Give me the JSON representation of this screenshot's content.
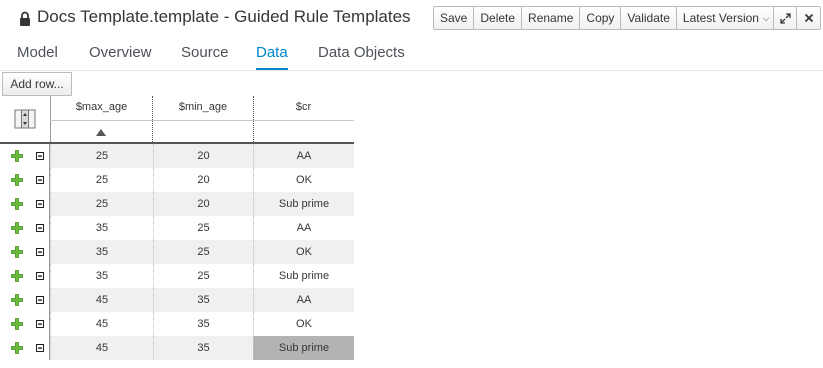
{
  "window": {
    "title": "Docs Template.template - Guided Rule Templates"
  },
  "toolbar": {
    "buttons": [
      "Save",
      "Delete",
      "Rename",
      "Copy",
      "Validate"
    ],
    "version_label": "Latest Version"
  },
  "tabs": [
    "Model",
    "Overview",
    "Source",
    "Data",
    "Data Objects"
  ],
  "active_tab": "Data",
  "grid": {
    "add_row_label": "Add row...",
    "columns": [
      "$max_age",
      "$min_age",
      "$cr"
    ],
    "sorted_column": "$max_age",
    "sort_direction": "ascending",
    "rows": [
      [
        "25",
        "20",
        "AA"
      ],
      [
        "25",
        "20",
        "OK"
      ],
      [
        "25",
        "20",
        "Sub prime"
      ],
      [
        "35",
        "25",
        "AA"
      ],
      [
        "35",
        "25",
        "OK"
      ],
      [
        "35",
        "25",
        "Sub prime"
      ],
      [
        "45",
        "35",
        "AA"
      ],
      [
        "45",
        "35",
        "OK"
      ],
      [
        "45",
        "35",
        "Sub prime"
      ]
    ],
    "selected_cell": {
      "row": 9,
      "column": "$cr"
    }
  },
  "colors": {
    "accent": "#0088ce",
    "add_icon": "#3f9c35",
    "selected_cell": "#b3b3b3"
  }
}
